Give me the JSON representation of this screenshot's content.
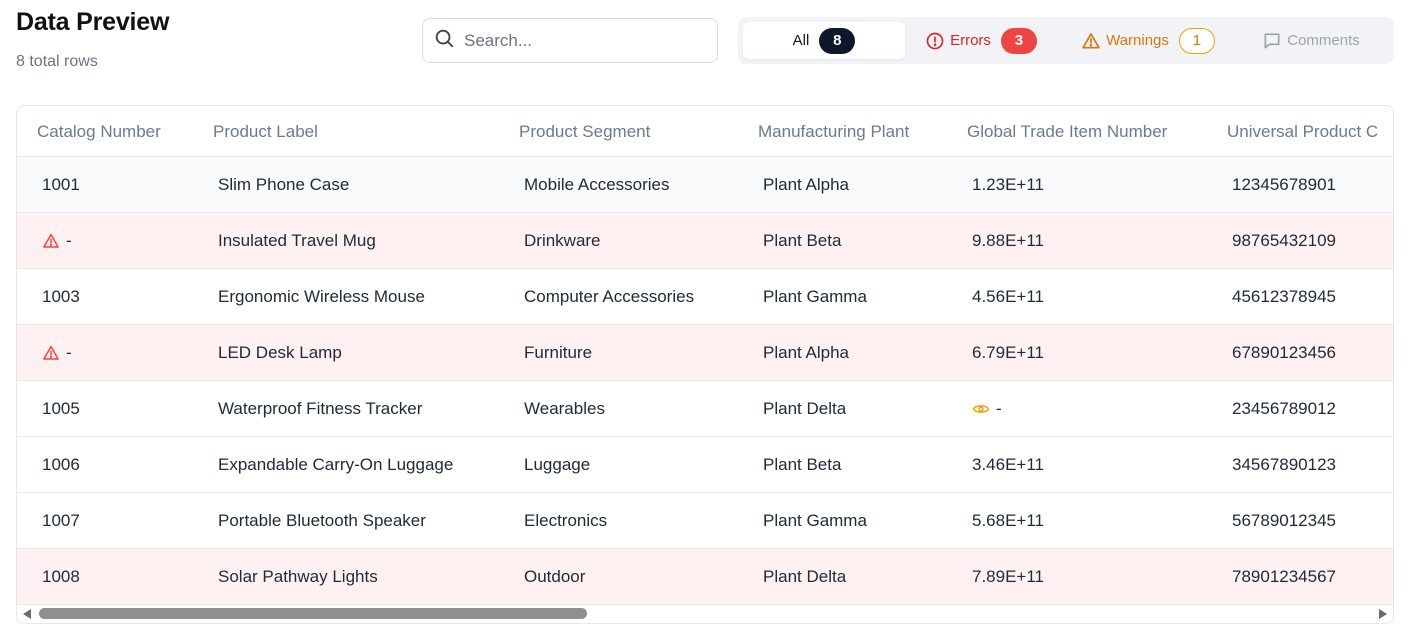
{
  "header": {
    "title": "Data Preview",
    "subtitle": "8 total rows"
  },
  "search": {
    "placeholder": "Search...",
    "icon": "search-icon"
  },
  "filters": {
    "all": {
      "label": "All",
      "count": "8"
    },
    "errors": {
      "label": "Errors",
      "count": "3",
      "icon": "alert-circle-icon",
      "color": "#dc2626"
    },
    "warnings": {
      "label": "Warnings",
      "count": "1",
      "icon": "alert-triangle-icon",
      "color": "#d97706"
    },
    "comments": {
      "label": "Comments",
      "icon": "comment-icon",
      "color": "#9ca3af"
    }
  },
  "table": {
    "columns": [
      "Catalog Number",
      "Product Label",
      "Product Segment",
      "Manufacturing Plant",
      "Global Trade Item Number",
      "Universal Product C"
    ],
    "rows": [
      {
        "catalog": "1001",
        "label": "Slim Phone Case",
        "segment": "Mobile Accessories",
        "plant": "Plant Alpha",
        "gtin": "1.23E+11",
        "upc": "12345678901"
      },
      {
        "catalog": "-",
        "label": "Insulated Travel Mug",
        "segment": "Drinkware",
        "plant": "Plant Beta",
        "gtin": "9.88E+11",
        "upc": "98765432109"
      },
      {
        "catalog": "1003",
        "label": "Ergonomic Wireless Mouse",
        "segment": "Computer Accessories",
        "plant": "Plant Gamma",
        "gtin": "4.56E+11",
        "upc": "45612378945"
      },
      {
        "catalog": "-",
        "label": "LED Desk Lamp",
        "segment": "Furniture",
        "plant": "Plant Alpha",
        "gtin": "6.79E+11",
        "upc": "67890123456"
      },
      {
        "catalog": "1005",
        "label": "Waterproof Fitness Tracker",
        "segment": "Wearables",
        "plant": "Plant Delta",
        "gtin": "-",
        "upc": "23456789012"
      },
      {
        "catalog": "1006",
        "label": "Expandable Carry-On Luggage",
        "segment": "Luggage",
        "plant": "Plant Beta",
        "gtin": "3.46E+11",
        "upc": "34567890123"
      },
      {
        "catalog": "1007",
        "label": "Portable Bluetooth Speaker",
        "segment": "Electronics",
        "plant": "Plant Gamma",
        "gtin": "5.68E+11",
        "upc": "56789012345"
      },
      {
        "catalog": "1008",
        "label": "Solar Pathway Lights",
        "segment": "Outdoor",
        "plant": "Plant Delta",
        "gtin": "7.89E+11",
        "upc": "78901234567"
      }
    ],
    "error_color": "#ef4444",
    "warning_color": "#f59e0b",
    "error_row_bg": "#fff1f1"
  }
}
